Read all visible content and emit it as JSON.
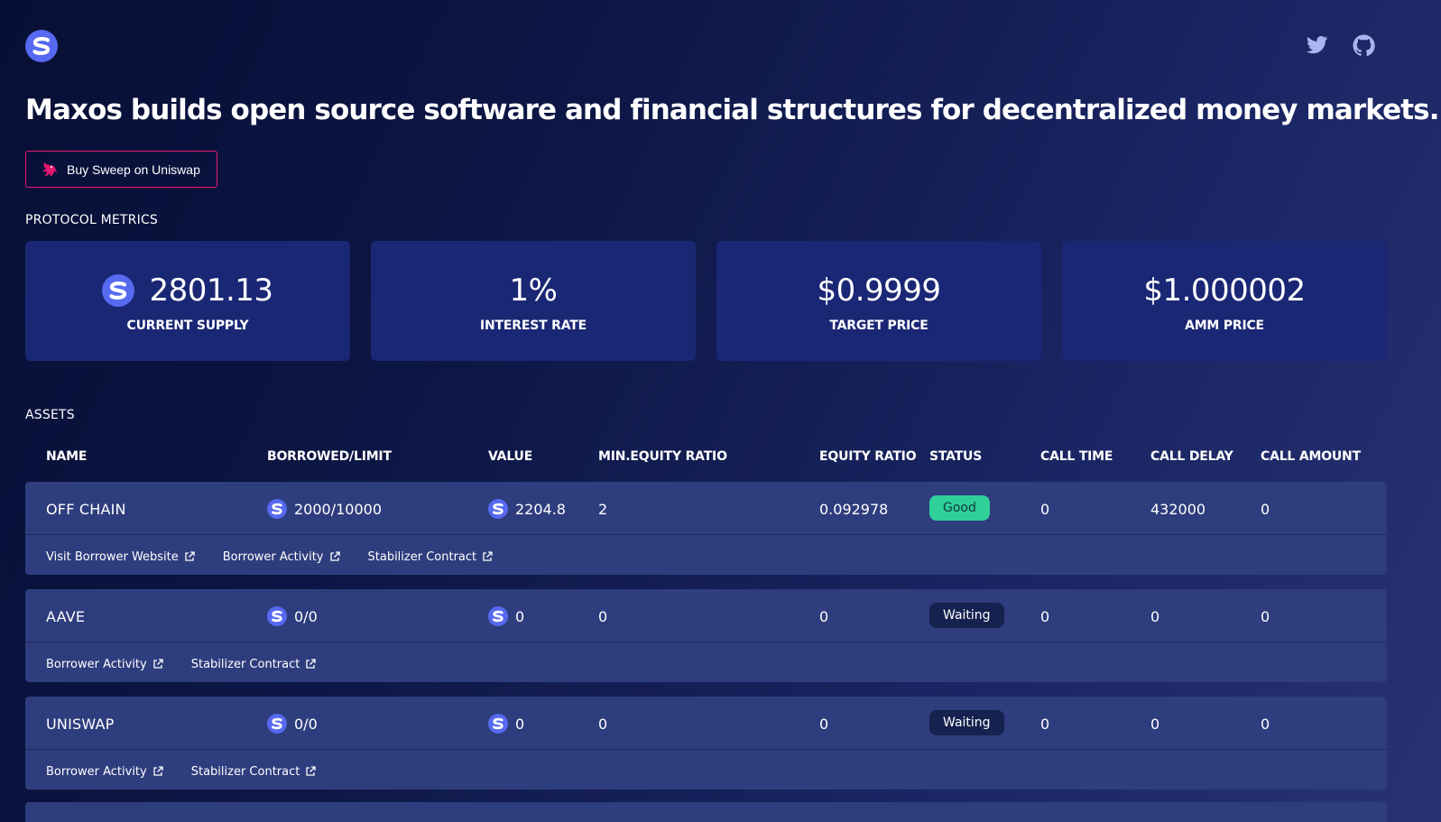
{
  "header": {
    "logo_icon": "sweep-logo-icon",
    "social": [
      {
        "name": "twitter-icon"
      },
      {
        "name": "github-icon"
      }
    ]
  },
  "headline": "Maxos builds open source software and financial structures for decentralized money markets.",
  "buy_button": {
    "label": "Buy Sweep on Uniswap",
    "icon": "uniswap-icon",
    "border_color": "#e5196f"
  },
  "metrics_title": "PROTOCOL METRICS",
  "metrics": [
    {
      "value": "2801.13",
      "label": "CURRENT SUPPLY",
      "icon": "sweep-logo-icon"
    },
    {
      "value": "1%",
      "label": "INTEREST RATE"
    },
    {
      "value": "$0.9999",
      "label": "TARGET PRICE"
    },
    {
      "value": "$1.000002",
      "label": "AMM PRICE"
    }
  ],
  "assets_title": "ASSETS",
  "columns": [
    "NAME",
    "BORROWED/LIMIT",
    "VALUE",
    "MIN.EQUITY RATIO",
    "EQUITY RATIO",
    "STATUS",
    "CALL TIME",
    "CALL DELAY",
    "CALL AMOUNT"
  ],
  "assets": [
    {
      "name": "OFF CHAIN",
      "borrowed_limit": "2000/10000",
      "value": "2204.8",
      "min_equity_ratio": "2",
      "equity_ratio": "0.092978",
      "status": "Good",
      "call_time": "0",
      "call_delay": "432000",
      "call_amount": "0",
      "links": [
        "Visit Borrower Website",
        "Borrower Activity",
        "Stabilizer Contract"
      ]
    },
    {
      "name": "AAVE",
      "borrowed_limit": "0/0",
      "value": "0",
      "min_equity_ratio": "0",
      "equity_ratio": "0",
      "status": "Waiting",
      "call_time": "0",
      "call_delay": "0",
      "call_amount": "0",
      "links": [
        "Borrower Activity",
        "Stabilizer Contract"
      ]
    },
    {
      "name": "UNISWAP",
      "borrowed_limit": "0/0",
      "value": "0",
      "min_equity_ratio": "0",
      "equity_ratio": "0",
      "status": "Waiting",
      "call_time": "0",
      "call_delay": "0",
      "call_amount": "0",
      "links": [
        "Borrower Activity",
        "Stabilizer Contract"
      ]
    }
  ],
  "colors": {
    "status_good": "#2fd198",
    "status_waiting": "#15214f",
    "card_bg": "#1a2775",
    "row_bg": "#2e3d7d"
  }
}
